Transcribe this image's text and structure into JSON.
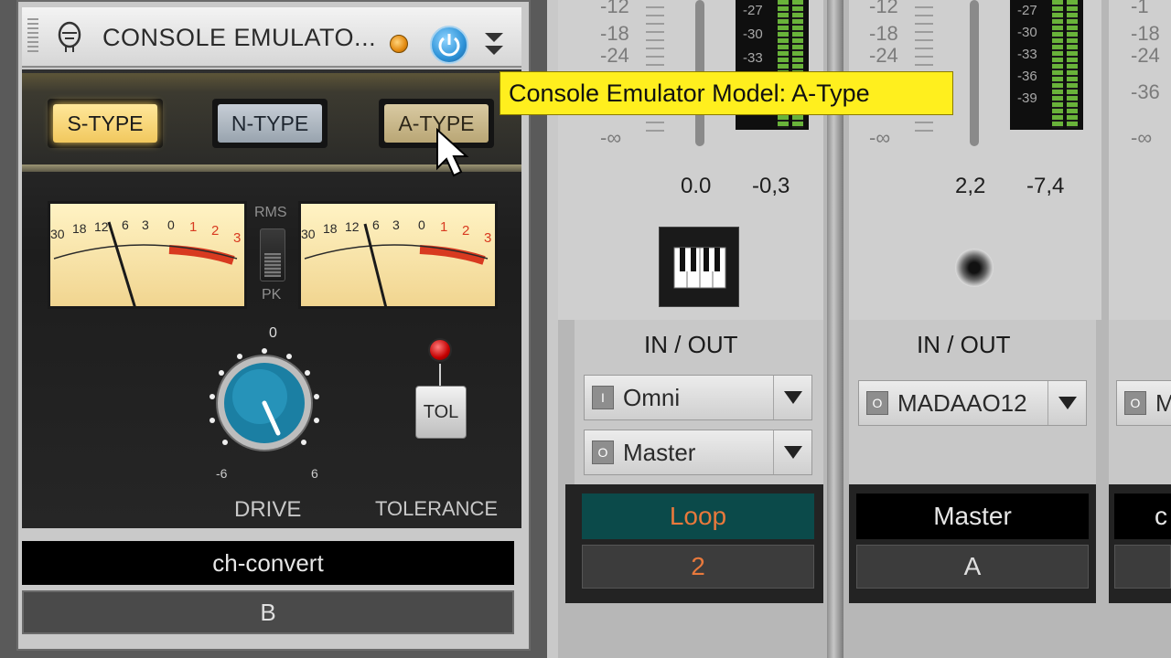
{
  "plugin": {
    "title": "CONSOLE EMULATO...",
    "type_buttons": [
      "S-TYPE",
      "N-TYPE",
      "A-TYPE"
    ],
    "selected_type": "S-TYPE",
    "meter_mode": {
      "top": "RMS",
      "bottom": "PK"
    },
    "vu_scale": [
      "30",
      "18",
      "12",
      "6",
      "3",
      "0",
      "1",
      "2",
      "3"
    ],
    "drive": {
      "label": "DRIVE",
      "scale_top": "0",
      "scale_min": "-6",
      "scale_max": "6"
    },
    "tolerance": {
      "label": "TOLERANCE",
      "button": "TOL"
    },
    "track_name": "ch-convert",
    "bus": "B"
  },
  "tooltip": "Console Emulator Model: A-Type",
  "strips": [
    {
      "db_labels": [
        "-12",
        "-18",
        "-24",
        "-∞"
      ],
      "meter_scale": [
        "-27",
        "-30",
        "-33"
      ],
      "gain_left": "0.0",
      "gain_right": "-0,3",
      "icon": "keyboard-icon",
      "io_header": "IN / OUT",
      "input": "Omni",
      "input_badge": "I",
      "output": "Master",
      "output_badge": "O",
      "name": "Loop",
      "route": "2"
    },
    {
      "db_labels": [
        "-12",
        "-18",
        "-24",
        "-∞"
      ],
      "meter_scale": [
        "-27",
        "-30",
        "-33",
        "-36",
        "-39"
      ],
      "gain_left": "2,2",
      "gain_right": "-7,4",
      "icon": "speaker-icon",
      "io_header": "IN / OUT",
      "output": "MADAAO12",
      "output_badge": "O",
      "name": "Master",
      "route": "A"
    },
    {
      "db_labels": [
        "-1",
        "-18",
        "-24",
        "-36",
        "-∞"
      ],
      "output": "M",
      "output_badge": "O",
      "name": "c"
    }
  ],
  "colors": {
    "tooltip_bg": "#ffef1e",
    "loop_bg": "#0b4a4a",
    "loop_text": "#e8793c",
    "power_blue": "#2e93d8",
    "vu_red": "#d83a20",
    "meter_green": "#69b33a"
  }
}
